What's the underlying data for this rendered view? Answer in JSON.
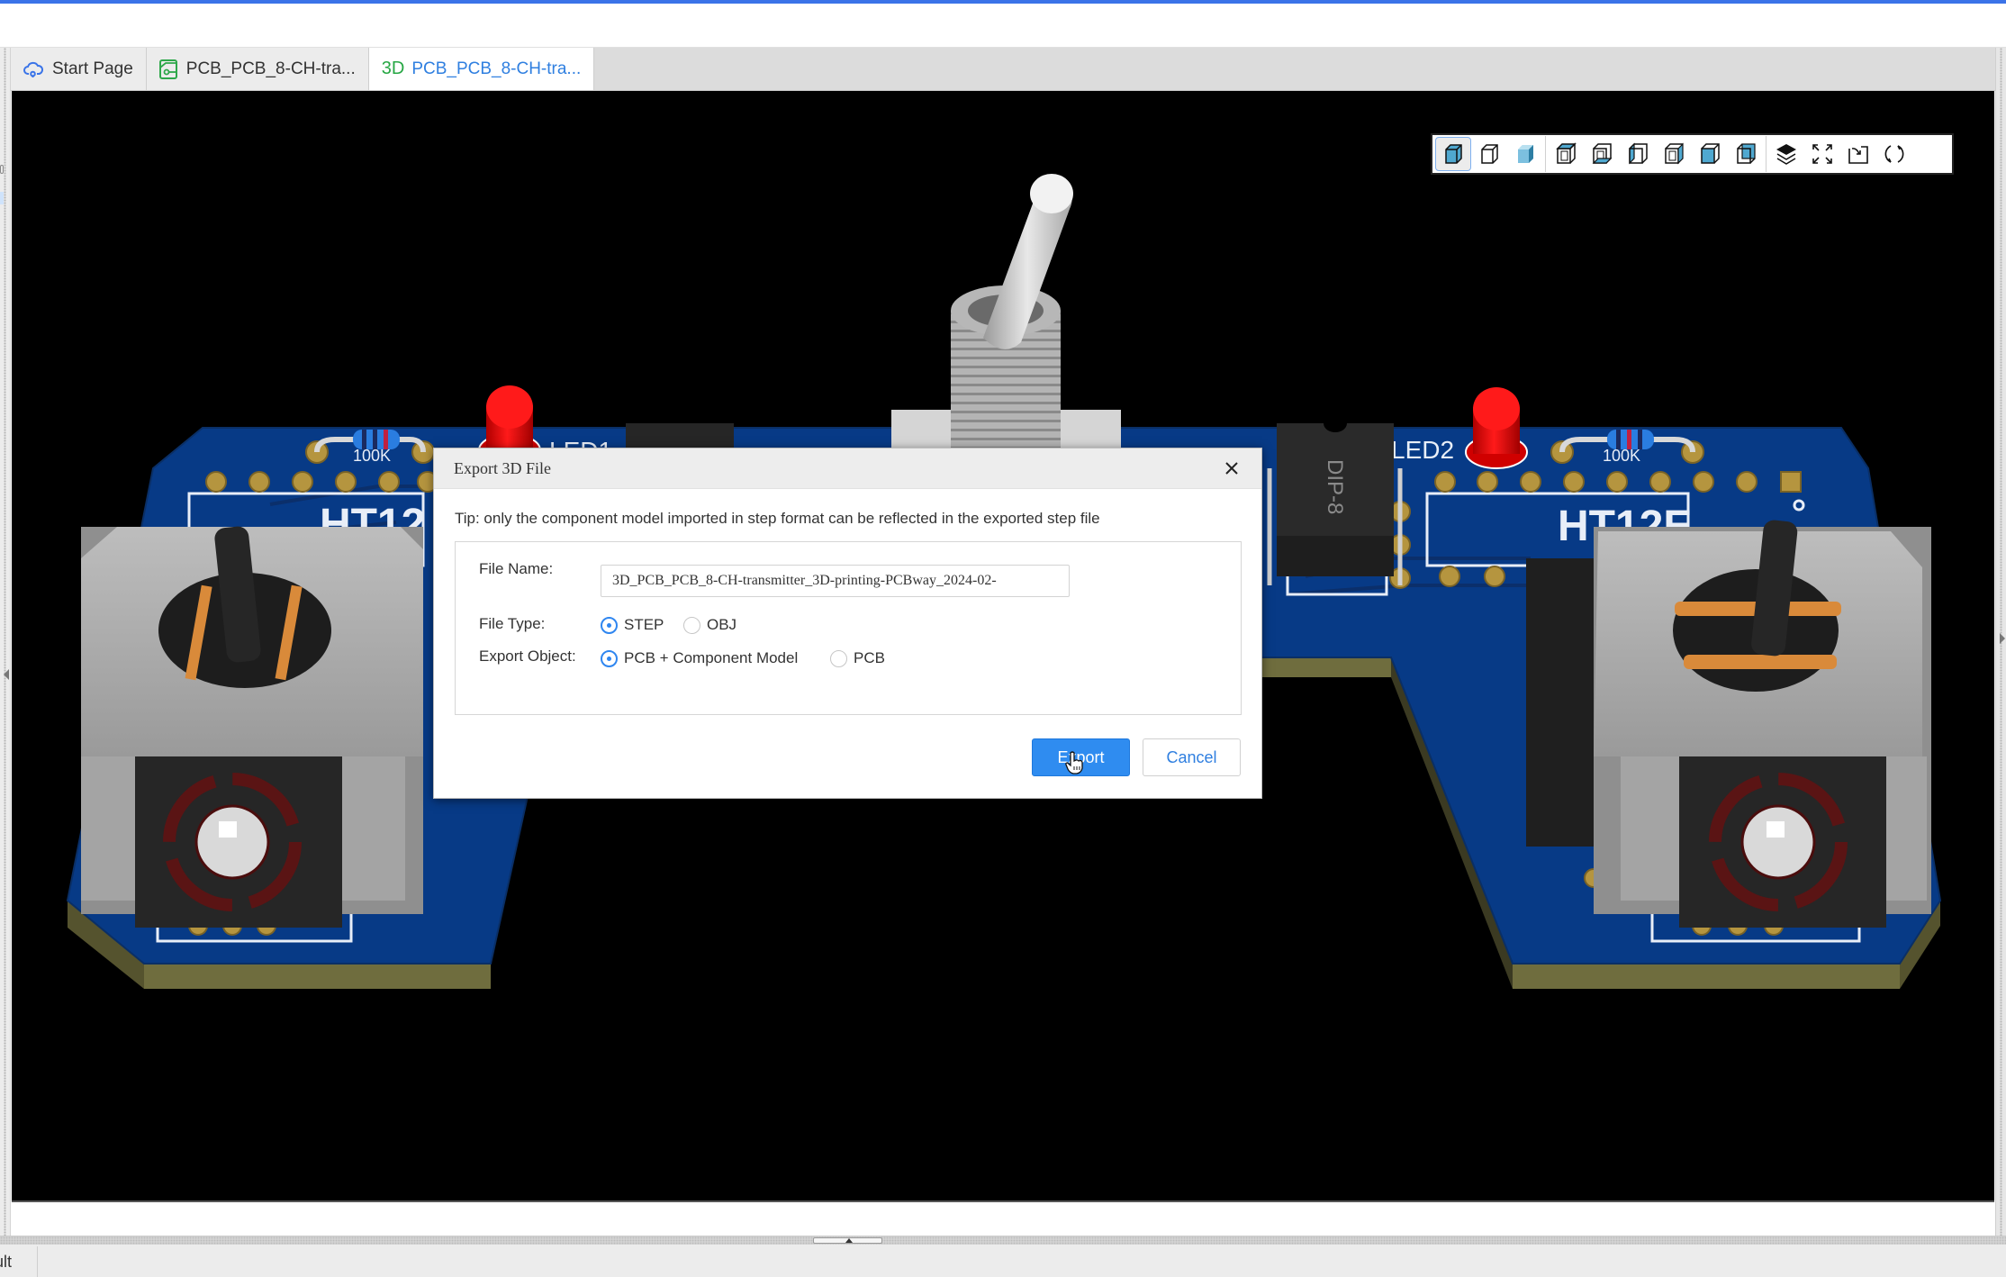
{
  "tabs": [
    {
      "label": "Start Page",
      "icon": "cloud-icon",
      "active": false
    },
    {
      "label": "PCB_PCB_8-CH-tra...",
      "icon": "pcb-icon",
      "active": false
    },
    {
      "label": "PCB_PCB_8-CH-tra...",
      "icon": "3d-icon",
      "icon_text": "3D",
      "active": true
    }
  ],
  "toolbar3d": {
    "groups": [
      [
        {
          "name": "solid-view-icon",
          "tooltip": "Solid",
          "active": true
        },
        {
          "name": "wireframe-view-icon",
          "tooltip": "Wireframe",
          "active": false
        },
        {
          "name": "transparent-view-icon",
          "tooltip": "Transparent",
          "active": false
        }
      ],
      [
        {
          "name": "top-view-icon",
          "tooltip": "Top"
        },
        {
          "name": "bottom-view-icon",
          "tooltip": "Bottom"
        },
        {
          "name": "left-view-icon",
          "tooltip": "Left"
        },
        {
          "name": "right-view-icon",
          "tooltip": "Right"
        },
        {
          "name": "front-view-icon",
          "tooltip": "Front"
        },
        {
          "name": "back-view-icon",
          "tooltip": "Back"
        }
      ],
      [
        {
          "name": "layers-icon",
          "tooltip": "Layers"
        },
        {
          "name": "fit-view-icon",
          "tooltip": "Fit"
        },
        {
          "name": "export-view-icon",
          "tooltip": "Export"
        },
        {
          "name": "rotate-icon",
          "tooltip": "Rotate"
        }
      ]
    ]
  },
  "scene": {
    "silkscreen": {
      "ic_left": "HT12",
      "ic_right": "HT12E",
      "led_left": "LED1",
      "led_right": "LED2",
      "resistor_left": "100K",
      "resistor_right": "100K",
      "dip": "DIP-8"
    },
    "colors": {
      "board": "#073a86",
      "board_edge": "#6f6d3e",
      "silk": "#e8eef8",
      "pad": "#b5953f",
      "led": "#ff0000",
      "metal": "#a9a9a9",
      "plastic": "#262626"
    }
  },
  "dialog": {
    "title": "Export 3D File",
    "tip": "Tip: only the component model imported in step format can be reflected in the exported step file",
    "file_name_label": "File Name:",
    "file_name_value": "3D_PCB_PCB_8-CH-transmitter_3D-printing-PCBway_2024-02-",
    "file_type_label": "File Type:",
    "file_type_options": [
      {
        "label": "STEP",
        "checked": true
      },
      {
        "label": "OBJ",
        "checked": false
      }
    ],
    "export_object_label": "Export Object:",
    "export_object_options": [
      {
        "label": "PCB + Component Model",
        "checked": true
      },
      {
        "label": "PCB",
        "checked": false
      }
    ],
    "export_button": "Export",
    "cancel_button": "Cancel",
    "accent": "#2f8cf0"
  },
  "bottom_panel": {
    "tab_label": "Result"
  }
}
